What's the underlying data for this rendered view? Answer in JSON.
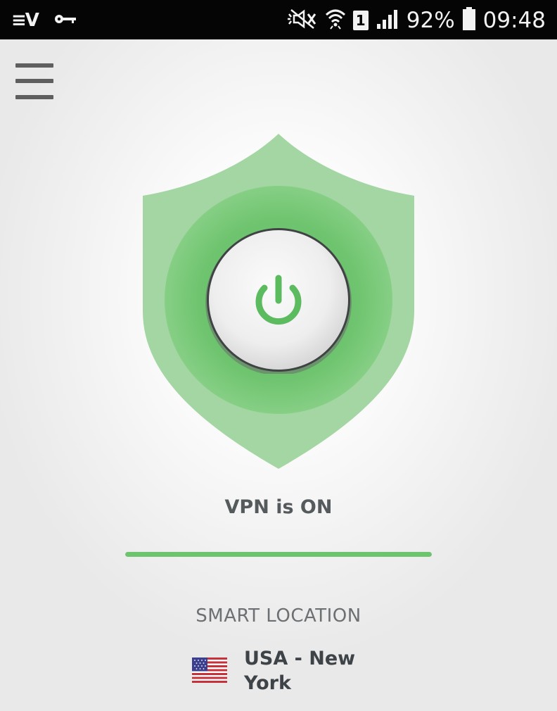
{
  "status_bar": {
    "app_logo": "≡V",
    "left_icons": [
      "vpn-logo-icon",
      "key-icon"
    ],
    "right_icons": [
      "silent-mode-icon",
      "wifi-icon",
      "sim-icon",
      "signal-icon",
      "battery-icon"
    ],
    "sim_slot": "1",
    "battery": "92%",
    "battery_level": 0.92,
    "time": "09:48"
  },
  "menu": {
    "icon": "hamburger-menu-icon"
  },
  "vpn": {
    "status_text": "VPN is ON",
    "connected": true,
    "progress": 1.0,
    "power_icon": "power-icon"
  },
  "location": {
    "heading": "SMART LOCATION",
    "name": "USA - New York",
    "flag_icon": "us-flag-icon"
  },
  "colors": {
    "accent_green": "#6cc46e",
    "shield_light": "#a3d6a2",
    "shield_inner": "#7fcb7e",
    "text_dark": "#3d4347",
    "status_bar": "#050505"
  }
}
